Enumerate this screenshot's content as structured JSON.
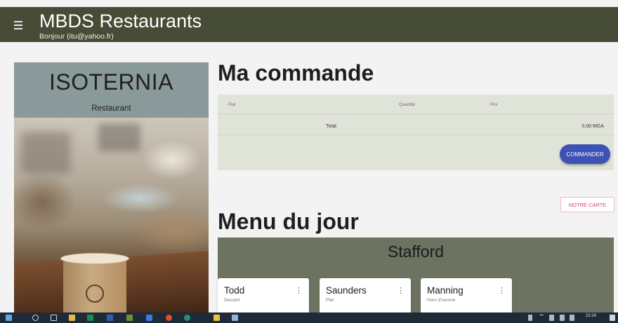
{
  "app": {
    "title": "MBDS Restaurants",
    "greeting": "Bonjour (itu@yahoo.fr)",
    "menu_icon": "hamburger-menu-icon"
  },
  "restaurant": {
    "name": "ISOTERNIA",
    "type": "Restaurant"
  },
  "order": {
    "title": "Ma commande",
    "columns": [
      "Plat",
      "Quantité",
      "Prix"
    ],
    "total_label": "Total",
    "total_value": "0,00 MGA",
    "submit_label": "COMMANDER"
  },
  "carte_button": "NOTRE CARTE",
  "menu_du_jour": {
    "title": "Menu du jour",
    "menu_name": "Stafford",
    "dishes": [
      {
        "name": "Todd",
        "category": "Dessert"
      },
      {
        "name": "Saunders",
        "category": "Plat"
      },
      {
        "name": "Manning",
        "category": "Hors d'oeuvre"
      }
    ],
    "more_icon": "more-vert-icon"
  },
  "taskbar": {
    "time": "22:24"
  },
  "colors": {
    "appbar": "#474c36",
    "accent_button": "#3e51b5",
    "secondary_text": "#e0405e",
    "order_box": "#dfe3d8",
    "menu_box": "#6d7361"
  }
}
